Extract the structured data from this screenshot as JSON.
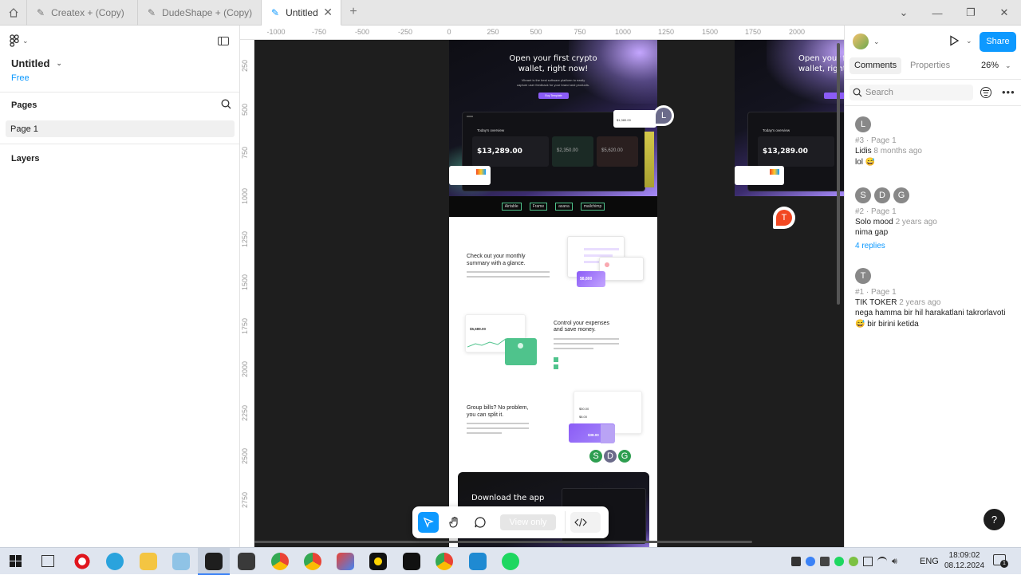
{
  "tabs": [
    {
      "label": "Createx + (Copy)",
      "active": false
    },
    {
      "label": "DudeShape + (Copy)",
      "active": false
    },
    {
      "label": "Untitled",
      "active": true
    }
  ],
  "left_panel": {
    "file_name": "Untitled",
    "plan": "Free",
    "pages_heading": "Pages",
    "page_item": "Page 1",
    "layers_heading": "Layers"
  },
  "ruler": {
    "h_ticks": [
      "-1000",
      "-750",
      "-500",
      "-250",
      "0",
      "250",
      "500",
      "750",
      "1000",
      "1250",
      "1500",
      "1750",
      "2000"
    ],
    "v_ticks": [
      "250",
      "500",
      "750",
      "1000",
      "1250",
      "1500",
      "1750",
      "2000",
      "2250",
      "2500",
      "2750"
    ]
  },
  "right_panel": {
    "share_label": "Share",
    "tab_comments": "Comments",
    "tab_properties": "Properties",
    "zoom": "26%",
    "search_placeholder": "Search",
    "comments": [
      {
        "avatars": [
          "L"
        ],
        "meta": "#3 · Page 1",
        "author": "Lidis",
        "time": "8 months ago",
        "text": "lol",
        "emoji": "😅",
        "replies": ""
      },
      {
        "avatars": [
          "S",
          "D",
          "G"
        ],
        "meta": "#2 · Page 1",
        "author": "Solo mood",
        "time": "2 years ago",
        "text": "nima gap",
        "emoji": "",
        "replies": "4 replies"
      },
      {
        "avatars": [
          "T"
        ],
        "meta": "#1 · Page 1",
        "author": "TIK TOKER",
        "time": "2 years ago",
        "text": "nega hamma bir hil harakatlani takrorlavoti",
        "text2": "bir birini ketida",
        "emoji": "😅",
        "replies": ""
      }
    ],
    "help": "?"
  },
  "design": {
    "hero_title_1": "Open your first crypto",
    "hero_title_2": "wallet, right now!",
    "hero_sub_1": "Vibrant is the best software platform to easily",
    "hero_sub_2": "capture user feedback for your brand and products.",
    "hero_cta": "Buy Template",
    "overview_title": "Today's overview",
    "balance_main": "$13,289.00",
    "balance_2": "$2,350.00",
    "balance_3": "$5,620.00",
    "float_value": "$1,380.00",
    "logos": [
      "Airtable",
      "Frame",
      "asana",
      "mailchimp"
    ],
    "sec1_title_1": "Check out your monthly",
    "sec1_title_2": "summary with a glance.",
    "sec1_card_value": "$8,800",
    "sec2_title_1": "Control your expenses",
    "sec2_title_2": "and save money.",
    "sec2_card_value": "$5,689.00",
    "sec3_title_1": "Group bills? No problem,",
    "sec3_title_2": "you can split it.",
    "sec3_card_value_1": "$50.00",
    "sec3_card_value_2": "$8.00",
    "sec3_card_value_3": "$38.00",
    "download_title": "Download the app",
    "avatars_group": [
      "S",
      "D",
      "G"
    ],
    "marker_l": "L",
    "marker_t": "T"
  },
  "toolbar": {
    "view_only": "View only"
  },
  "taskbar": {
    "lang": "ENG",
    "time": "18:09:02",
    "date": "08.12.2024",
    "notif_count": "1"
  },
  "colors": {
    "accent_blue": "#0d99ff",
    "purple": "#a78bfa",
    "green": "#4fc38c",
    "red": "#f24822"
  }
}
